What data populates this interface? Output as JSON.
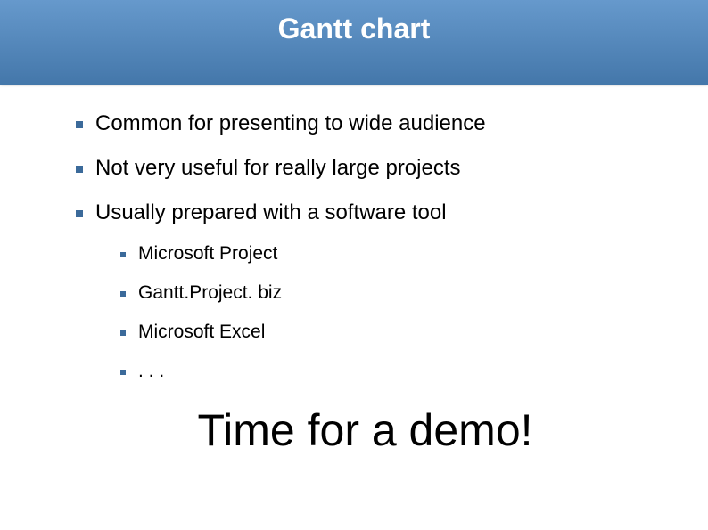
{
  "slide": {
    "title": "Gantt chart",
    "bullets": [
      {
        "text": "Common for presenting to wide audience"
      },
      {
        "text": "Not very useful for really large projects"
      },
      {
        "text": "Usually prepared with a software tool"
      }
    ],
    "sub_bullets": [
      {
        "text": "Microsoft Project"
      },
      {
        "text": "Gantt.Project. biz"
      },
      {
        "text": "Microsoft Excel"
      },
      {
        "text": ". . ."
      }
    ],
    "callout": "Time for a demo!"
  }
}
